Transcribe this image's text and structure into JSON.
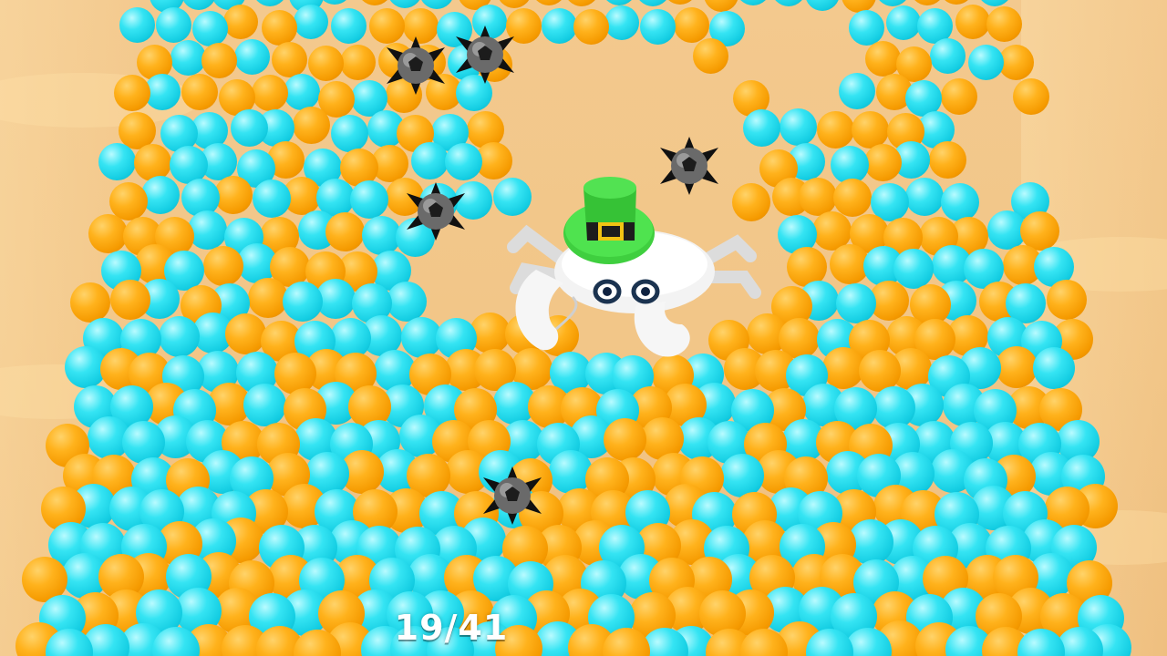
{
  "hud": {
    "progress_text": "19/41",
    "collected": 19,
    "total": 41
  },
  "colors": {
    "sand": "#f2c688",
    "ball_orange": "#ffb21c",
    "ball_cyan": "#14cde2",
    "hat_green": "#3fcf3f",
    "crab_body": "#f2f2f2",
    "mine": "#444444"
  },
  "icons": {
    "player": "crab-with-leprechaun-hat-icon",
    "hazard": "spiked-mine-icon"
  }
}
